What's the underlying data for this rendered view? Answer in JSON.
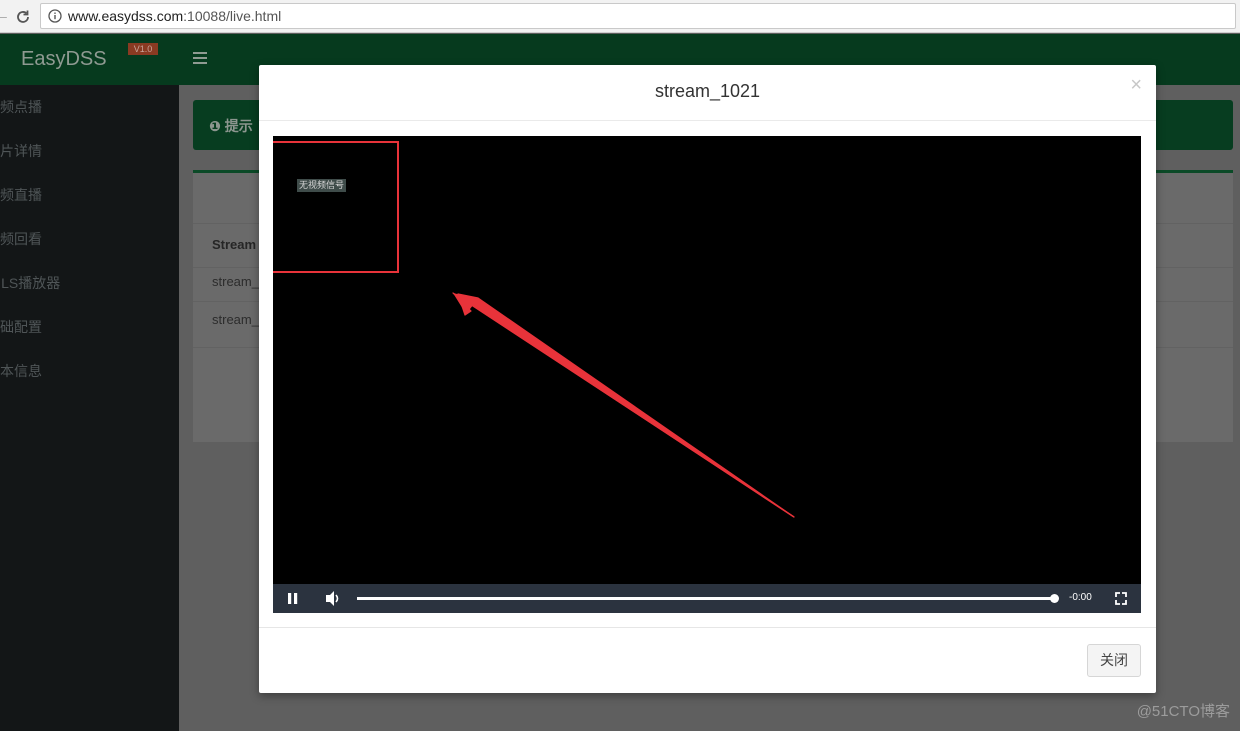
{
  "browser": {
    "url_host": "www.easydss.com",
    "url_path": ":10088/live.html"
  },
  "app": {
    "brand": "EasyDSS",
    "version": "V1.0"
  },
  "sidebar": {
    "items": [
      {
        "label": "视频点播"
      },
      {
        "label": "切片详情"
      },
      {
        "label": "视频直播"
      },
      {
        "label": "视频回看"
      },
      {
        "label": "HLS播放器"
      },
      {
        "label": "基础配置"
      },
      {
        "label": "版本信息"
      }
    ]
  },
  "alert": {
    "text": "❶ 提示"
  },
  "table": {
    "header": "Stream",
    "rows": [
      "stream_",
      "stream_"
    ]
  },
  "modal": {
    "title": "stream_1021",
    "close_x": "×",
    "player": {
      "overlay_text": "无视频信号",
      "time": "-0:00",
      "progress_fraction": 1.0
    },
    "close_button": "关闭"
  },
  "watermark": "@51CTO博客",
  "colors": {
    "topbar": "#063a1e",
    "annotation": "#e8333a",
    "control_bar": "#2b333f"
  }
}
